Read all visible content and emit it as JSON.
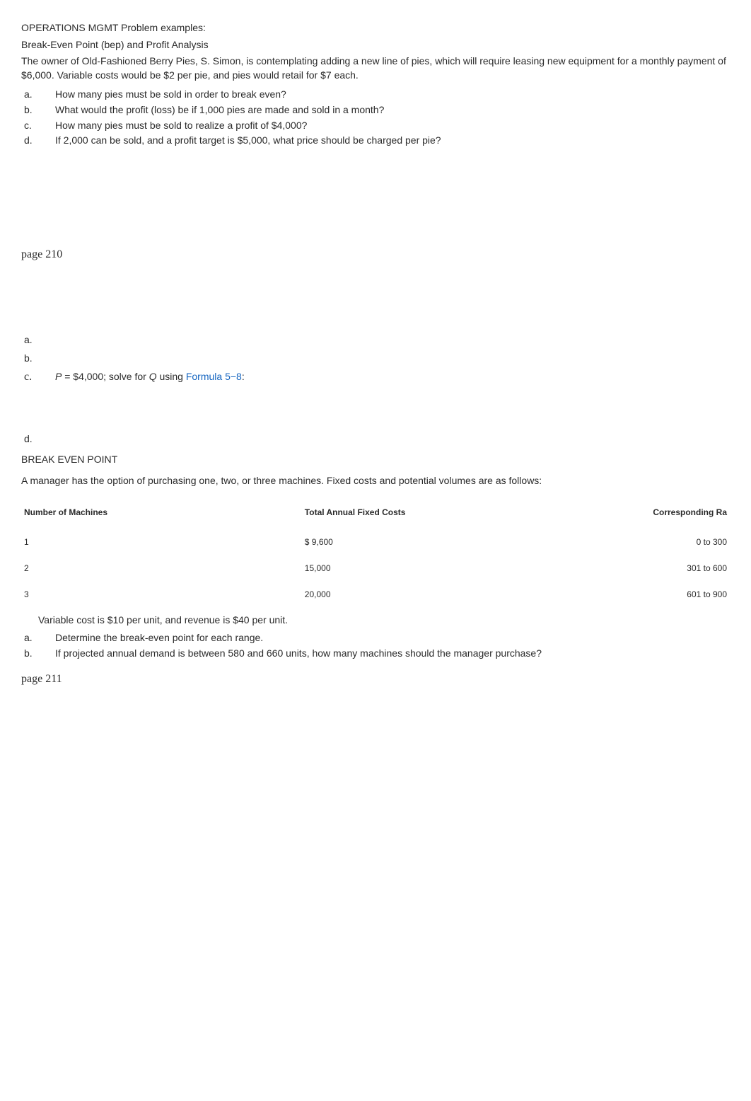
{
  "header": {
    "title": "OPERATIONS MGMT Problem examples:",
    "subtitle": "Break-Even Point (bep) and Profit Analysis",
    "intro": "The owner of Old-Fashioned Berry Pies, S. Simon, is contemplating adding a new line of pies, which will require leasing new equipment for a monthly payment of $6,000. Variable costs would be $2 per pie, and pies would retail for $7 each."
  },
  "questions1": [
    {
      "letter": "a.",
      "text": "How many pies must be sold in order to break even?"
    },
    {
      "letter": "b.",
      "text": "What would the profit (loss) be if 1,000 pies are made and sold in a month?"
    },
    {
      "letter": "c.",
      "text": "How many pies must be sold to realize a profit of $4,000?"
    },
    {
      "letter": "d.",
      "text": "If 2,000 can be sold, and a profit target is $5,000, what price should be charged per pie?"
    }
  ],
  "page_ref_1": "page 210",
  "answers": {
    "a": {
      "letter": "a."
    },
    "b": {
      "letter": "b."
    },
    "c": {
      "letter": "c.",
      "prefix_var": "P",
      "prefix_rest": " = $4,000; solve for ",
      "var2": "Q",
      "mid": " using ",
      "link": "Formula 5−8",
      "suffix": ":"
    },
    "d": {
      "letter": "d."
    }
  },
  "section2": {
    "heading": "BREAK EVEN POINT",
    "intro": "A manager has the option of purchasing one, two, or three machines. Fixed costs and potential volumes are as follows:"
  },
  "table": {
    "headers": {
      "num": "Number of Machines",
      "fixed": "Total Annual Fixed Costs",
      "range": "Corresponding Ra"
    },
    "rows": [
      {
        "num": "1",
        "fixed": "$  9,600",
        "range": "0 to 300"
      },
      {
        "num": "2",
        "fixed": "15,000",
        "range": "301 to 600"
      },
      {
        "num": "3",
        "fixed": "20,000",
        "range": "601 to 900"
      }
    ]
  },
  "note": "Variable cost is $10 per unit, and revenue is $40 per unit.",
  "questions2": [
    {
      "letter": "a.",
      "text": "Determine the break-even point for each range."
    },
    {
      "letter": "b.",
      "text": "If projected annual demand is between 580 and 660 units, how many machines should the manager purchase?"
    }
  ],
  "page_ref_2": "page 211"
}
